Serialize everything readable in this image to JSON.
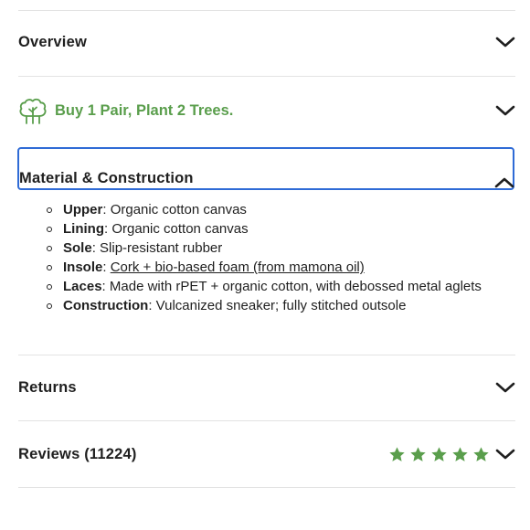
{
  "accordion": {
    "overview_label": "Overview",
    "plant_label": "Buy 1 Pair, Plant 2 Trees.",
    "material_label": "Material & Construction",
    "returns_label": "Returns",
    "reviews_label": "Reviews (11224)"
  },
  "material": {
    "items": [
      {
        "key": "Upper",
        "sep": ": ",
        "value": "Organic cotton canvas"
      },
      {
        "key": "Lining",
        "sep": ": ",
        "value": "Organic cotton canvas"
      },
      {
        "key": "Sole",
        "sep": ": ",
        "value": "Slip-resistant rubber"
      },
      {
        "key": "Insole",
        "sep": ": ",
        "value": "Cork + bio-based foam (from mamona oil)"
      },
      {
        "key": "Laces",
        "sep": ": ",
        "value": "Made with rPET + organic cotton, with debossed metal aglets"
      },
      {
        "key": "Construction",
        "sep": ": ",
        "value": "Vulcanized sneaker; fully stitched outsole"
      }
    ]
  },
  "reviews": {
    "rating": 5,
    "max": 5
  },
  "colors": {
    "accent_green": "#5a9e4c",
    "focus_blue": "#2f6bd6",
    "star_green": "#5a9e4c"
  },
  "icons": {
    "plant": "tree-icon",
    "expand": "chevron-down-icon",
    "collapse": "chevron-up-icon"
  }
}
